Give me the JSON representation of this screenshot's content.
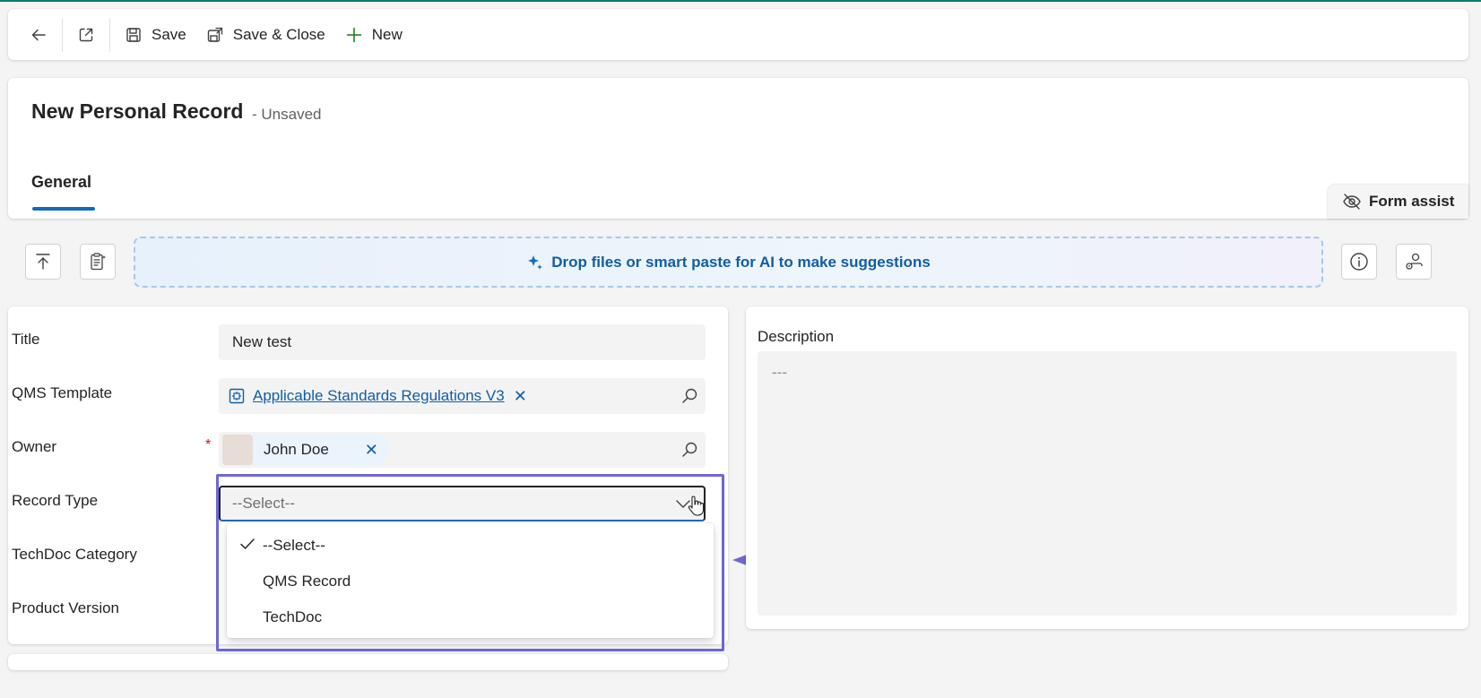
{
  "toolbar": {
    "save_label": "Save",
    "save_close_label": "Save & Close",
    "new_label": "New"
  },
  "header": {
    "title": "New Personal Record",
    "status": "- Unsaved",
    "tab_general": "General",
    "form_assist_label": "Form assist"
  },
  "dropzone": {
    "text": "Drop files or smart paste for AI to make suggestions"
  },
  "form": {
    "title_label": "Title",
    "title_value": "New test",
    "qms_template_label": "QMS Template",
    "qms_template_value": "Applicable Standards Regulations V3",
    "owner_label": "Owner",
    "owner_required": "*",
    "owner_value": "John Doe",
    "record_type_label": "Record Type",
    "record_type_value": "--Select--",
    "techdoc_category_label": "TechDoc Category",
    "product_version_label": "Product Version"
  },
  "dropdown": {
    "options": [
      "--Select--",
      "QMS Record",
      "TechDoc"
    ],
    "selected_index": 0
  },
  "description": {
    "label": "Description",
    "value": "---"
  },
  "colors": {
    "accent": "#0f6cbd",
    "highlight": "#6e66d6",
    "required": "#c50f1f"
  }
}
